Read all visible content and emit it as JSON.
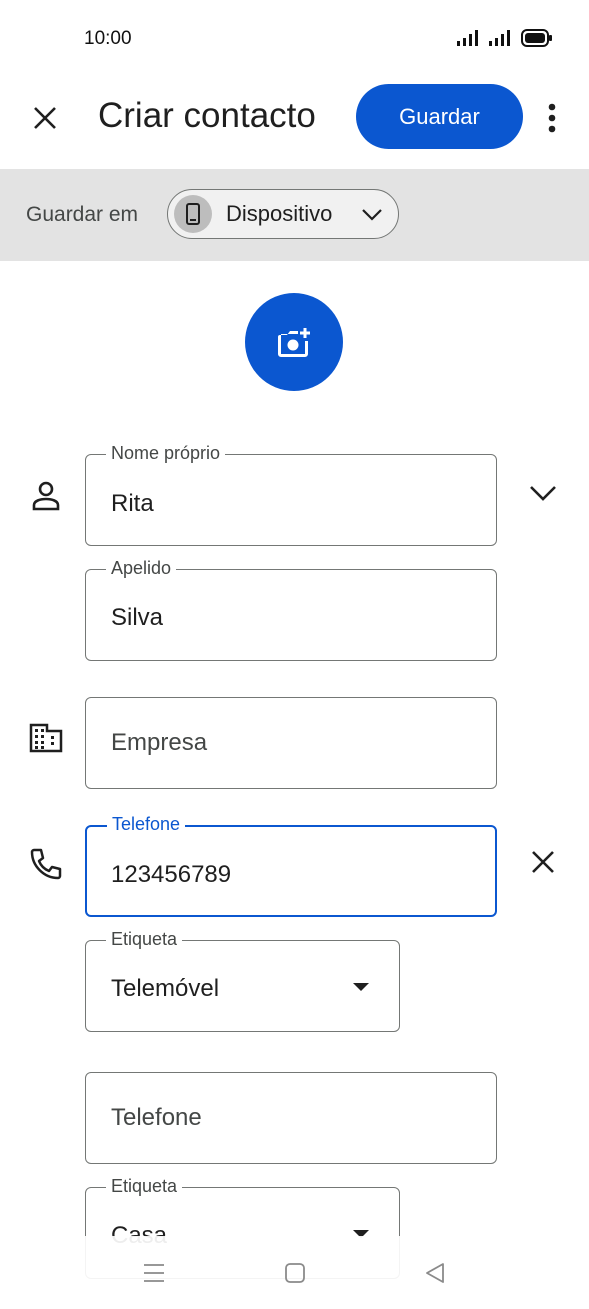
{
  "status_bar": {
    "time": "10:00"
  },
  "app_bar": {
    "title": "Criar contacto",
    "save_label": "Guardar"
  },
  "save_in": {
    "label": "Guardar em",
    "account": "Dispositivo"
  },
  "form": {
    "first_name": {
      "label": "Nome próprio",
      "value": "Rita"
    },
    "last_name": {
      "label": "Apelido",
      "value": "Silva"
    },
    "company": {
      "placeholder": "Empresa"
    },
    "phone1": {
      "label": "Telefone",
      "value": "123456789"
    },
    "phone1_type": {
      "label": "Etiqueta",
      "value": "Telemóvel"
    },
    "phone2": {
      "placeholder": "Telefone"
    },
    "phone2_type": {
      "label": "Etiqueta",
      "value": "Casa"
    }
  },
  "colors": {
    "accent": "#0b57d0",
    "band": "#e3e3e3",
    "outline": "#747775"
  },
  "icons": [
    "close-icon",
    "more-vert-icon",
    "phone-device-icon",
    "chevron-down-icon",
    "add-photo-icon",
    "person-icon",
    "business-icon",
    "phone-icon",
    "clear-icon",
    "menu-nav-icon",
    "home-nav-icon",
    "back-nav-icon"
  ]
}
